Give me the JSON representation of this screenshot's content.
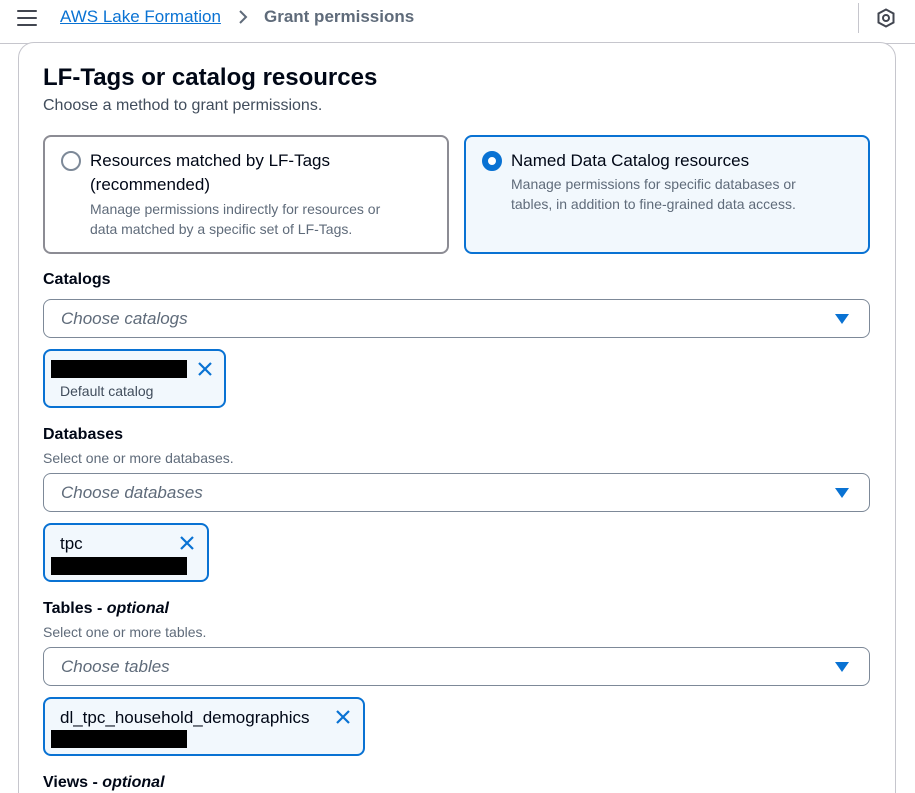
{
  "breadcrumb": {
    "parent": "AWS Lake Formation",
    "current": "Grant permissions"
  },
  "icons": {
    "menu": "hamburger-menu-icon",
    "separator": "chevron-right-icon",
    "shield": "shield-icon",
    "dropdown": "caret-down-icon",
    "remove": "close-icon"
  },
  "colors": {
    "accent": "#0972d3",
    "selected_bg": "#f2f8fd"
  },
  "section": {
    "title": "LF-Tags or catalog resources",
    "description": "Choose a method to grant permissions."
  },
  "method_options": [
    {
      "label_line1": "Resources matched by LF-Tags",
      "label_line2": "(recommended)",
      "desc_line1": "Manage permissions indirectly for resources or",
      "desc_line2": "data matched by a specific set of LF-Tags.",
      "selected": false
    },
    {
      "label_line1": "Named Data Catalog resources",
      "desc_line1": "Manage permissions for specific databases or",
      "desc_line2": "tables, in addition to fine-grained data access.",
      "selected": true
    }
  ],
  "catalogs": {
    "label": "Catalogs",
    "placeholder": "Choose catalogs",
    "tokens": [
      {
        "subtitle": "Default catalog"
      }
    ]
  },
  "databases": {
    "label": "Databases",
    "hint": "Select one or more databases.",
    "placeholder": "Choose databases",
    "tokens": [
      {
        "title": "tpc"
      }
    ]
  },
  "tables": {
    "label": "Tables",
    "label_sep": " - ",
    "label_optional": "optional",
    "hint": "Select one or more tables.",
    "placeholder": "Choose tables",
    "tokens": [
      {
        "title": "dl_tpc_household_demographics"
      }
    ]
  },
  "views": {
    "label": "Views",
    "label_sep": " - ",
    "label_optional": "optional"
  }
}
